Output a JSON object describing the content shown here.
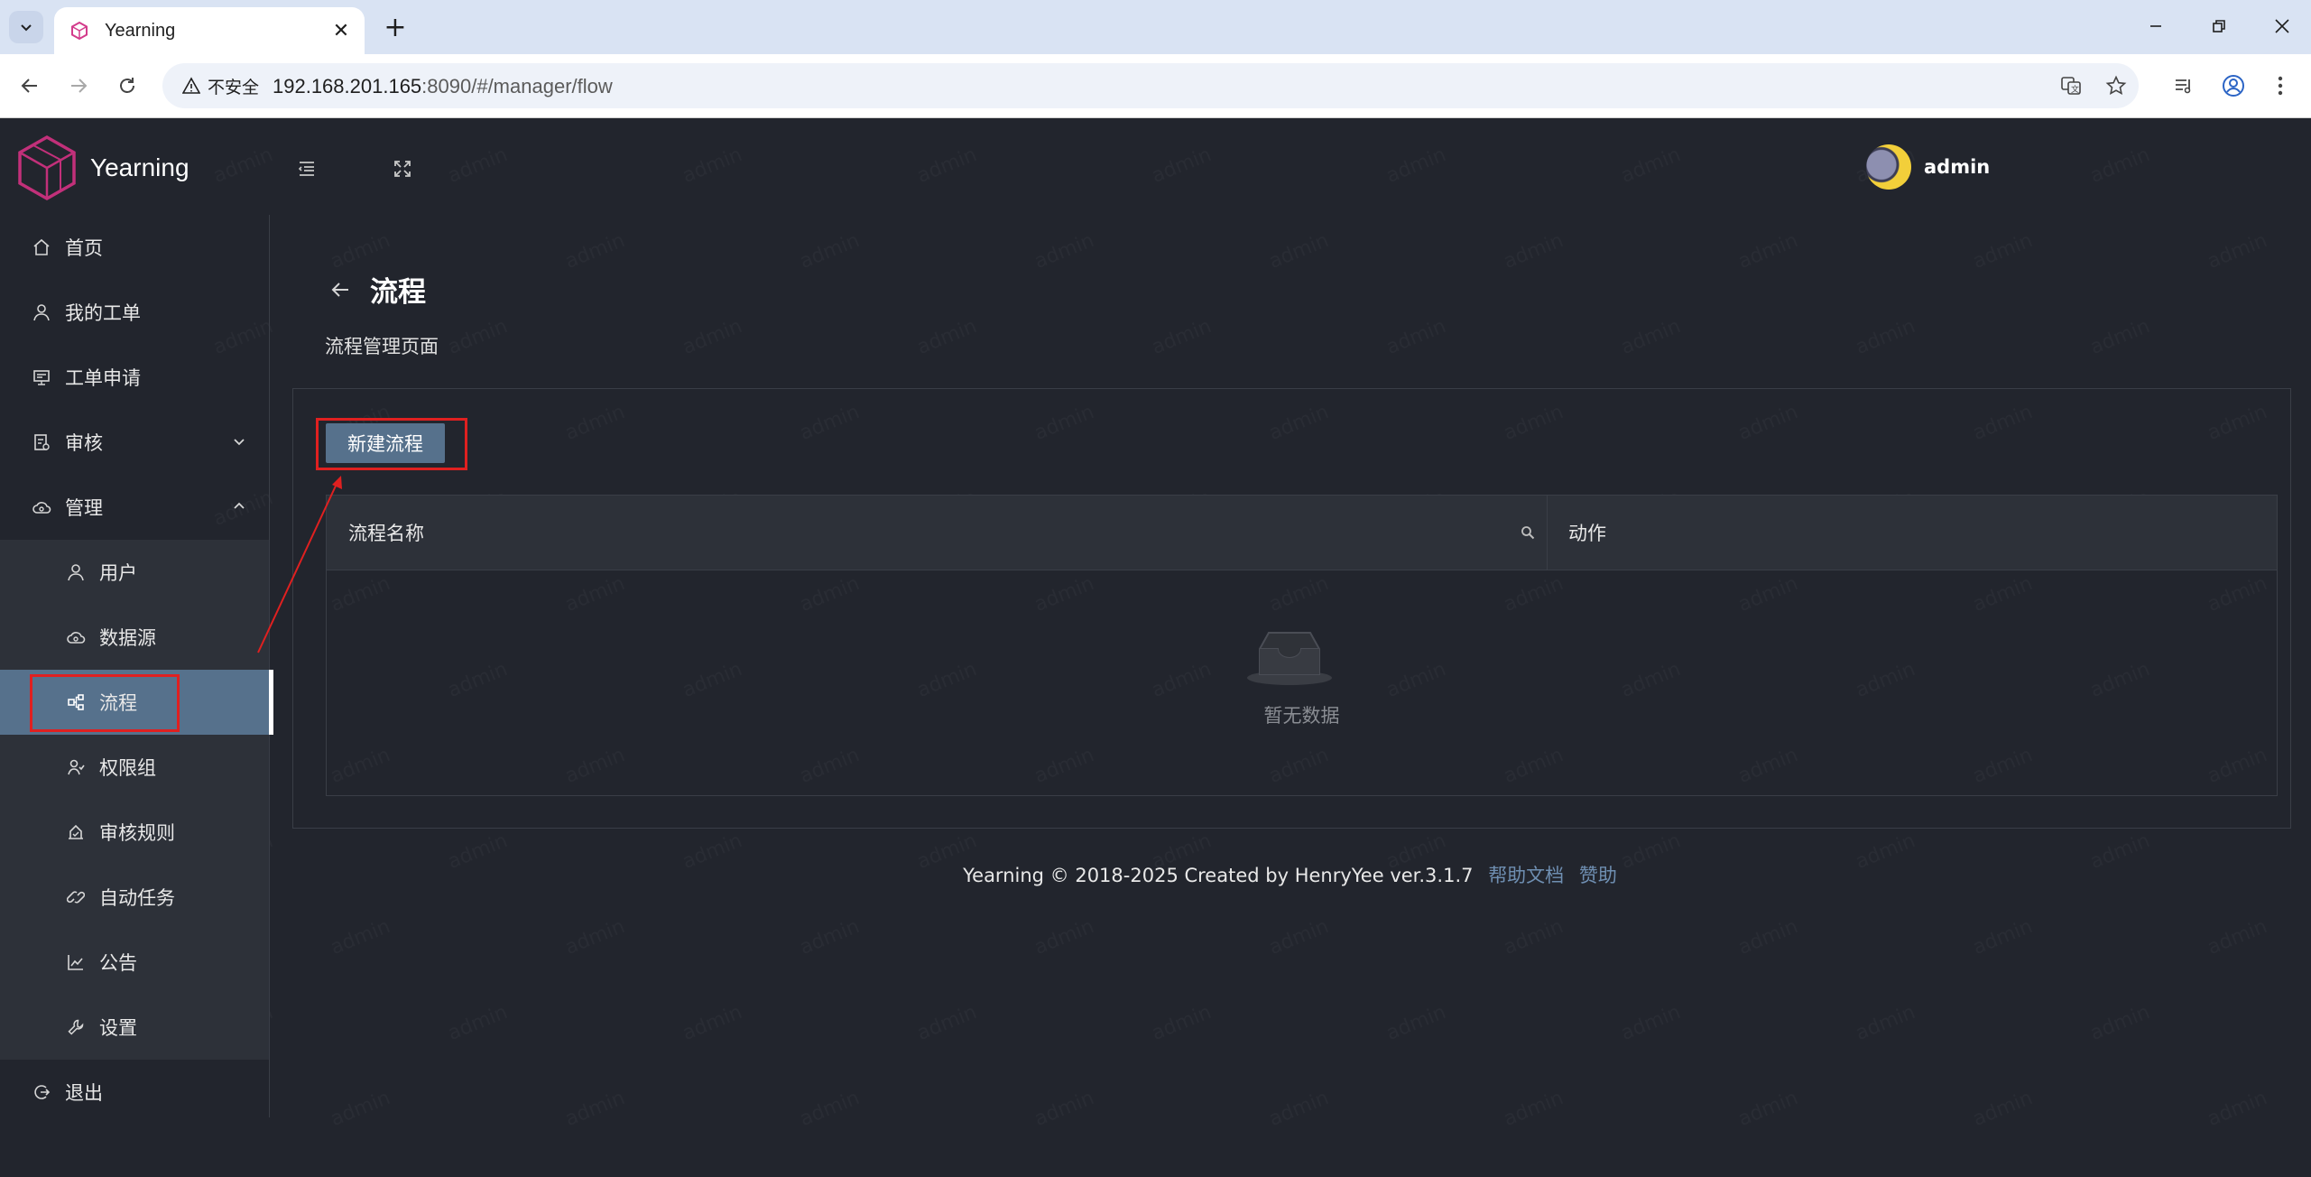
{
  "browser": {
    "tab_title": "Yearning",
    "security_label": "不安全",
    "url_host": "192.168.201.165",
    "url_rest": ":8090/#/manager/flow"
  },
  "app": {
    "brand": "Yearning",
    "user_name": "admin"
  },
  "sidebar": {
    "items": [
      {
        "label": "首页",
        "icon": "home-icon"
      },
      {
        "label": "我的工单",
        "icon": "user-icon"
      },
      {
        "label": "工单申请",
        "icon": "monitor-icon"
      },
      {
        "label": "审核",
        "icon": "audit-icon"
      },
      {
        "label": "管理",
        "icon": "cloud-icon"
      },
      {
        "label": "退出",
        "icon": "logout-icon"
      }
    ],
    "sub_items": [
      {
        "label": "用户",
        "icon": "user-icon"
      },
      {
        "label": "数据源",
        "icon": "cloud-icon"
      },
      {
        "label": "流程",
        "icon": "flow-icon"
      },
      {
        "label": "权限组",
        "icon": "group-icon"
      },
      {
        "label": "审核规则",
        "icon": "rule-icon"
      },
      {
        "label": "自动任务",
        "icon": "link-icon"
      },
      {
        "label": "公告",
        "icon": "chart-icon"
      },
      {
        "label": "设置",
        "icon": "wrench-icon"
      }
    ]
  },
  "page": {
    "title": "流程",
    "subtitle": "流程管理页面",
    "new_button": "新建流程",
    "table": {
      "columns": [
        "流程名称",
        "动作"
      ],
      "empty_text": "暂无数据"
    }
  },
  "footer": {
    "text": "Yearning © 2018-2025 Created by HenryYee ver.3.1.7",
    "help_link": "帮助文档",
    "sponsor_link": "赞助"
  },
  "colors": {
    "app_bg": "#22252d",
    "accent": "#56718c",
    "annotation": "#e02020"
  }
}
